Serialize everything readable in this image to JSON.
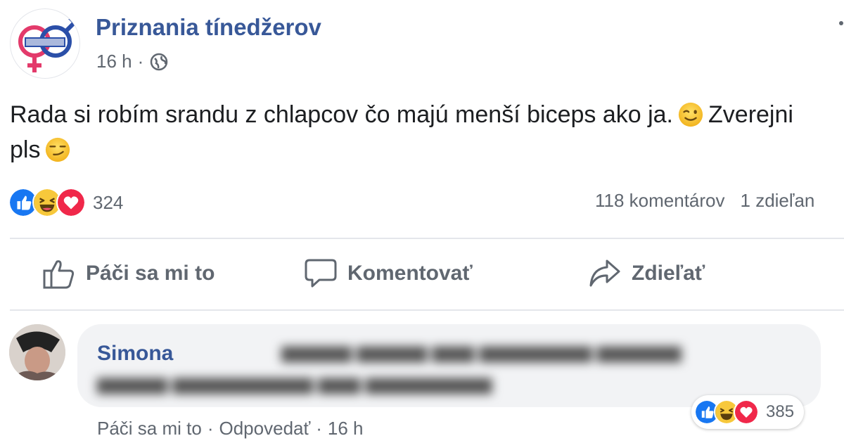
{
  "post": {
    "page_name": "Priznania tínedžerov",
    "time": "16 h",
    "separator": "·",
    "text_line1": "Rada si robím srandu z chlapcov čo majú menší biceps ako ja.",
    "text_line1_end": "Zverejni",
    "text_line2": "pls",
    "reaction_count": "324",
    "comments_count": "118 komentárov",
    "shares_count": "1 zdieľan"
  },
  "actions": {
    "like": "Páči sa mi to",
    "comment": "Komentovať",
    "share": "Zdieľať"
  },
  "comment": {
    "author": "Simona",
    "reaction_count": "385",
    "like": "Páči sa mi to",
    "reply": "Odpovedať",
    "time": "16 h",
    "separator": "·"
  },
  "colors": {
    "link": "#385898",
    "secondary_text": "#606770",
    "like_blue": "#1877f2",
    "love_red": "#f0284a",
    "haha_yellow": "#f7c83b"
  },
  "icons": [
    "globe-icon",
    "like-reaction-icon",
    "haha-reaction-icon",
    "love-reaction-icon",
    "wink-emoji",
    "smirk-emoji",
    "thumbs-up-icon",
    "speech-bubble-icon",
    "share-arrow-icon"
  ]
}
